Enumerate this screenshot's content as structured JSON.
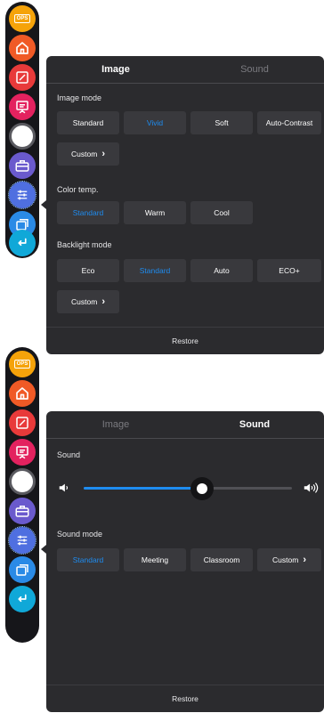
{
  "colors": {
    "accent": "#1e8cf0",
    "panel": "#2b2b2e",
    "button": "#39393d",
    "toolbar": "#16161a"
  },
  "toolbar": {
    "ops_label": "OPS",
    "items": [
      {
        "name": "ops-icon",
        "color": "#f5a30a"
      },
      {
        "name": "home-icon",
        "color": "#f05a26"
      },
      {
        "name": "annotate-icon",
        "color": "#e83a3a"
      },
      {
        "name": "whiteboard-icon",
        "color": "#e3225f"
      },
      {
        "name": "circle-icon",
        "color": "#ffffff"
      },
      {
        "name": "toolbox-icon",
        "color": "#6a5acd"
      },
      {
        "name": "settings-sliders-icon",
        "color": "#4f6fe0"
      },
      {
        "name": "windows-icon",
        "color": "#2a8ae6"
      },
      {
        "name": "back-icon",
        "color": "#10a8d8"
      }
    ]
  },
  "image_panel": {
    "tabs": [
      "Image",
      "Sound"
    ],
    "active_tab": "Image",
    "image_mode_label": "Image mode",
    "image_modes": [
      "Standard",
      "Vivid",
      "Soft",
      "Auto-Contrast"
    ],
    "image_mode_selected": "Vivid",
    "image_custom": "Custom",
    "color_temp_label": "Color temp.",
    "color_temps": [
      "Standard",
      "Warm",
      "Cool"
    ],
    "color_temp_selected": "Standard",
    "backlight_label": "Backlight mode",
    "backlight_modes": [
      "Eco",
      "Standard",
      "Auto",
      "ECO+"
    ],
    "backlight_selected": "Standard",
    "backlight_custom": "Custom",
    "restore": "Restore"
  },
  "sound_panel": {
    "tabs": [
      "Image",
      "Sound"
    ],
    "active_tab": "Sound",
    "sound_label": "Sound",
    "volume_fraction": 0.57,
    "sound_mode_label": "Sound mode",
    "sound_modes": [
      "Standard",
      "Meeting",
      "Classroom",
      "Custom"
    ],
    "sound_mode_selected": "Standard",
    "restore": "Restore"
  }
}
